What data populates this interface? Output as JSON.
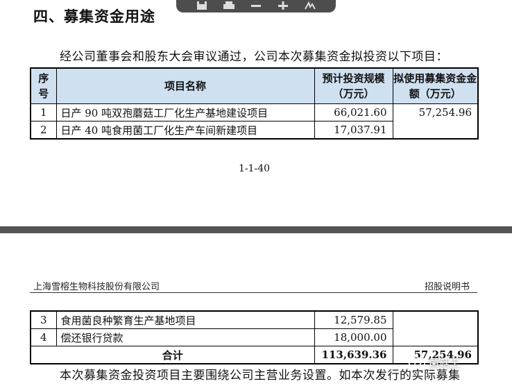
{
  "section_heading": "四、募集资金用途",
  "intro_text": "经公司董事会和股东大会审议通过，公司本次募集资金拟投资以下项目：",
  "table1": {
    "headers": {
      "seq": "序\n号",
      "name": "项目名称",
      "invest": "预计投资规模\n（万元）",
      "raise": "拟使用募集资金金\n额（万元）"
    },
    "rows": [
      {
        "seq": "1",
        "name": "日产 90 吨双孢蘑菇工厂化生产基地建设项目",
        "invest": "66,021.60",
        "raise": "57,254.96"
      },
      {
        "seq": "2",
        "name": "日产 40 吨食用菌工厂化生产车间新建项目",
        "invest": "17,037.91"
      }
    ]
  },
  "page_number": "1-1-40",
  "page_header": {
    "company": "上海雪榕生物科技股份有限公司",
    "doc_type": "招股说明书"
  },
  "table2": {
    "rows": [
      {
        "seq": "3",
        "name": "食用菌良种繁育生产基地项目",
        "invest": "12,579.85"
      },
      {
        "seq": "4",
        "name": "偿还银行贷款",
        "invest": "18,000.00"
      }
    ],
    "total": {
      "label": "合计",
      "invest": "113,639.36",
      "raise": "57,254.96"
    }
  },
  "footer_text": "本次募集资金投资项目主要围绕公司主营业务设置。如本次发行的实际募集",
  "watermark_text": "菌菇王",
  "colors": {
    "header_fill": "#cfe0f0",
    "toolbar": "#4d4d4d"
  }
}
